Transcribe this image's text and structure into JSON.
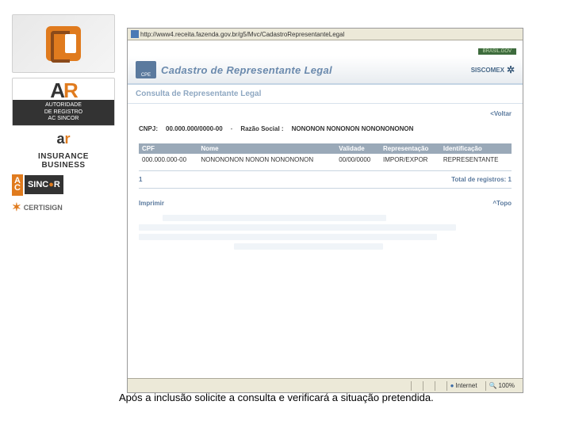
{
  "sidebar": {
    "ar_label_line1": "AUTORIDADE",
    "ar_label_line2": "DE REGISTRO",
    "ar_label_line3": "AC SINCOR",
    "insurance_line1": "INSURANCE",
    "insurance_line2": "BUSINESS",
    "sincor_ac": "AC",
    "sincor_name": "SINC",
    "sincor_r": "R",
    "certisign": "CERTISIGN"
  },
  "browser": {
    "url": "http://www4.receita.fazenda.gov.br/g5/Mvc/CadastroRepresentanteLegal"
  },
  "header": {
    "cpe": "CPE",
    "title": "Cadastro de Representante Legal",
    "siscomex": "SISCOMEX",
    "gov_banner": "BRASIL.GOV"
  },
  "page": {
    "title": "Consulta de Representante Legal",
    "voltar": "<Voltar",
    "filter": {
      "cnpj_label": "CNPJ:",
      "cnpj_value": "00.000.000/0000-00",
      "razao_label": "Razão Social :",
      "razao_value": "NONONON  NONONON  NONONONONON"
    },
    "table": {
      "cols": [
        "CPF",
        "Nome",
        "Validade",
        "Representação",
        "Identificação"
      ],
      "rows": [
        {
          "cpf": "000.000.000-00",
          "nome": "NONONONON NONON NONONONON",
          "validade": "00/00/0000",
          "rep": "IMPOR/EXPOR",
          "ident": "REPRESENTANTE"
        }
      ]
    },
    "pager": {
      "page": "1",
      "total": "Total de registros: 1"
    },
    "links": {
      "imprimir": "Imprimir",
      "topo": "^Topo"
    }
  },
  "status": {
    "internet": "Internet",
    "zoom": "100%"
  },
  "caption": "Após a inclusão solicite a consulta e verificará a situação pretendida."
}
